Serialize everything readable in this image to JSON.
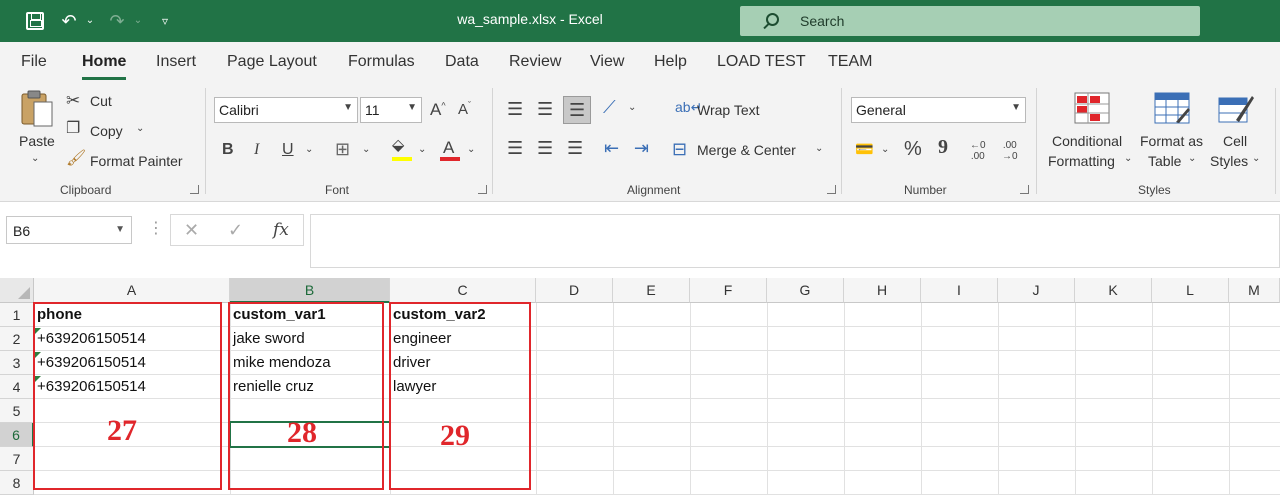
{
  "titlebar": {
    "window_title": "wa_sample.xlsx  -  Excel",
    "search_label": "Search"
  },
  "menu": {
    "tabs": [
      "File",
      "Home",
      "Insert",
      "Page Layout",
      "Formulas",
      "Data",
      "Review",
      "View",
      "Help",
      "LOAD TEST",
      "TEAM"
    ],
    "active_tab": "Home"
  },
  "ribbon": {
    "clipboard": {
      "paste": "Paste",
      "cut": "Cut",
      "copy": "Copy",
      "format_painter": "Format Painter",
      "label": "Clipboard"
    },
    "font": {
      "font_name": "Calibri",
      "font_size": "11",
      "bold": "B",
      "italic": "I",
      "underline": "U",
      "font_color_letter": "A",
      "highlight_color": "#ffff00",
      "font_color": "#e0262b",
      "label": "Font"
    },
    "alignment": {
      "wrap_text": "Wrap Text",
      "merge_center": "Merge & Center",
      "label": "Alignment"
    },
    "number": {
      "format": "General",
      "percent": "%",
      "comma": "9",
      "label": "Number"
    },
    "styles": {
      "conditional_formatting_1": "Conditional",
      "conditional_formatting_2": "Formatting",
      "format_as_table_1": "Format as",
      "format_as_table_2": "Table",
      "cell_styles_1": "Cell",
      "cell_styles_2": "Styles",
      "label": "Styles"
    }
  },
  "formula_bar": {
    "name_box": "B6",
    "content": ""
  },
  "grid": {
    "columns": [
      "A",
      "B",
      "C",
      "D",
      "E",
      "F",
      "G",
      "H",
      "I",
      "J",
      "K",
      "L",
      "M"
    ],
    "selected_column": "B",
    "rows": [
      "1",
      "2",
      "3",
      "4",
      "5",
      "6",
      "7",
      "8"
    ],
    "selected_row": "6",
    "cells": {
      "A1": "phone",
      "B1": "custom_var1",
      "C1": "custom_var2",
      "A2": "+639206150514",
      "B2": "jake sword",
      "C2": "engineer",
      "A3": "+639206150514",
      "B3": "mike mendoza",
      "C3": "driver",
      "A4": "+639206150514",
      "B4": "renielle cruz",
      "C4": "lawyer"
    }
  },
  "annotations": [
    "27",
    "28",
    "29"
  ],
  "colors": {
    "excel_green": "#217346",
    "annotation_red": "#e0262b"
  }
}
